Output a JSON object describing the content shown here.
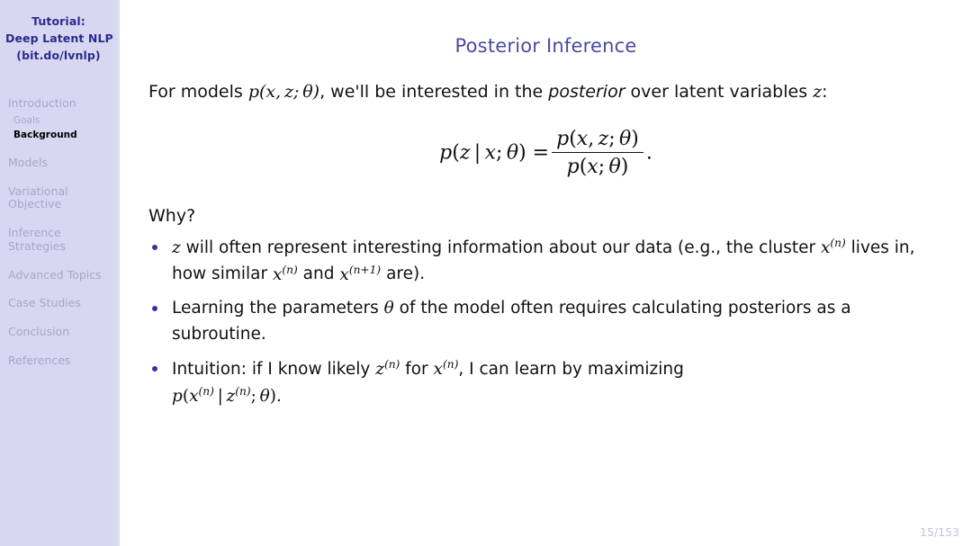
{
  "sidebar": {
    "title_lines": [
      "Tutorial:",
      "Deep Latent NLP",
      "(bit.do/lvnlp)"
    ],
    "nav": [
      {
        "label": "Introduction",
        "lines": [
          "Introduction"
        ],
        "type": "section",
        "active": false
      },
      {
        "label": "Goals",
        "lines": [
          "Goals"
        ],
        "type": "subsection",
        "active": false
      },
      {
        "label": "Background",
        "lines": [
          "Background"
        ],
        "type": "subsection",
        "active": true
      },
      {
        "label": "Models",
        "lines": [
          "Models"
        ],
        "type": "section",
        "active": false
      },
      {
        "label": "Variational Objective",
        "lines": [
          "Variational",
          "Objective"
        ],
        "type": "section",
        "active": false
      },
      {
        "label": "Inference Strategies",
        "lines": [
          "Inference",
          "Strategies"
        ],
        "type": "section",
        "active": false
      },
      {
        "label": "Advanced Topics",
        "lines": [
          "Advanced Topics"
        ],
        "type": "section",
        "active": false
      },
      {
        "label": "Case Studies",
        "lines": [
          "Case Studies"
        ],
        "type": "section",
        "active": false
      },
      {
        "label": "Conclusion",
        "lines": [
          "Conclusion"
        ],
        "type": "section",
        "active": false
      },
      {
        "label": "References",
        "lines": [
          "References"
        ],
        "type": "section",
        "active": false
      }
    ]
  },
  "slide": {
    "title": "Posterior Inference",
    "intro": {
      "part1": "For models ",
      "math1": "p(x, z; θ)",
      "part2": ", we'll be interested in the ",
      "emphasis": "posterior",
      "part3": " over latent variables ",
      "math2": "z",
      "part4": ":"
    },
    "equation": {
      "lhs": "p(z | x; θ) =",
      "numerator": "p(x, z; θ)",
      "denominator": "p(x; θ)",
      "trailing": "."
    },
    "why_label": "Why?",
    "bullets": [
      {
        "id": "bullet-latent-meaning",
        "text": "z will often represent interesting information about our data (e.g., the cluster x(n) lives in, how similar x(n) and x(n+1) are).",
        "segments": [
          {
            "kind": "math",
            "text": "z"
          },
          {
            "kind": "text",
            "text": " will often represent interesting information about our data (e.g., the"
          },
          {
            "kind": "break"
          },
          {
            "kind": "text",
            "text": "cluster "
          },
          {
            "kind": "mathsup",
            "base": "x",
            "sup": "(n)"
          },
          {
            "kind": "text",
            "text": " lives in, how similar "
          },
          {
            "kind": "mathsup",
            "base": "x",
            "sup": "(n)"
          },
          {
            "kind": "text",
            "text": " and "
          },
          {
            "kind": "mathsup",
            "base": "x",
            "sup": "(n+1)"
          },
          {
            "kind": "text",
            "text": " are)."
          }
        ]
      },
      {
        "id": "bullet-learning-parameters",
        "text": "Learning the parameters θ of the model often requires calculating posteriors as a subroutine.",
        "segments": [
          {
            "kind": "text",
            "text": "Learning the parameters "
          },
          {
            "kind": "math",
            "text": "θ"
          },
          {
            "kind": "text",
            "text": " of the model often requires calculating posteriors as a subroutine."
          }
        ]
      },
      {
        "id": "bullet-intuition",
        "text": "Intuition: if I know likely z(n) for x(n), I can learn by maximizing p(x(n) | z(n); θ).",
        "segments": [
          {
            "kind": "text",
            "text": "Intuition: if I know likely "
          },
          {
            "kind": "mathsup",
            "base": "z",
            "sup": "(n)"
          },
          {
            "kind": "text",
            "text": " for "
          },
          {
            "kind": "mathsup",
            "base": "x",
            "sup": "(n)"
          },
          {
            "kind": "text",
            "text": ", I can learn by maximizing"
          },
          {
            "kind": "break"
          },
          {
            "kind": "mathformula",
            "text": "p(x(n) | z(n); θ)."
          }
        ]
      }
    ],
    "page_number": "15/153"
  },
  "colors": {
    "sidebar_background": "#d8d7f1",
    "sidebar_title_text": "#2b2b8f",
    "sidebar_nav_text": "#a8a6c8",
    "sidebar_nav_active_text": "#000000",
    "frame_title": "#4b4b9e",
    "bullet_marker": "#3333a8",
    "page_number": "#c4c3dd",
    "body_text": "#111111",
    "content_background": "#ffffff"
  }
}
